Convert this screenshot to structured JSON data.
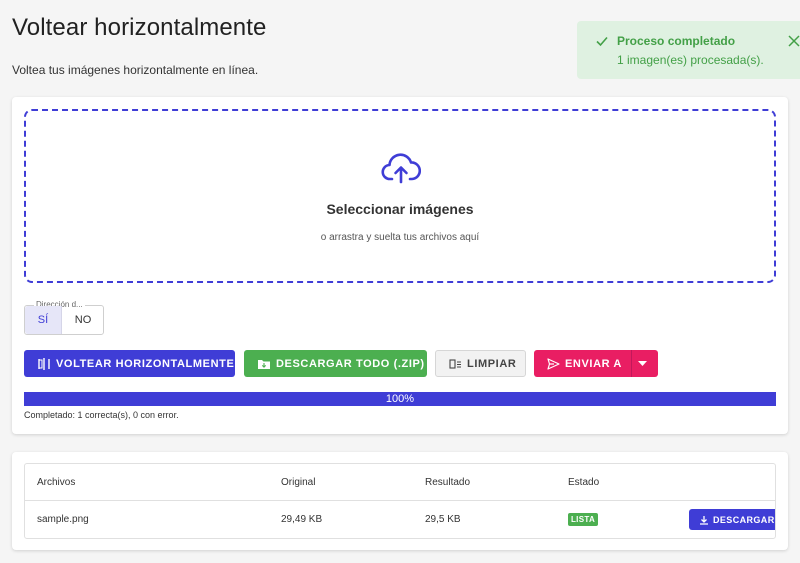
{
  "header": {
    "title": "Voltear horizontalmente",
    "subtitle": "Voltea tus imágenes horizontalmente en línea."
  },
  "toast": {
    "title": "Proceso completado",
    "message": "1 imagen(es) procesada(s).",
    "icon": "check-icon",
    "color": "#43a047"
  },
  "dropzone": {
    "icon": "cloud-upload-icon",
    "title": "Seleccionar imágenes",
    "hint": "o arrastra y suelta tus archivos aquí"
  },
  "direction": {
    "legend": "Dirección d...",
    "options": [
      "SÍ",
      "NO"
    ],
    "selected": "SÍ"
  },
  "actions": {
    "flip_label": "VOLTEAR HORIZONTALMENTE",
    "zip_label": "DESCARGAR TODO (.ZIP)",
    "clear_label": "LIMPIAR",
    "send_label": "ENVIAR A"
  },
  "progress": {
    "value": 100,
    "label": "100%",
    "status": "Completado: 1 correcta(s), 0 con error."
  },
  "files_table": {
    "headers": [
      "Archivos",
      "Original",
      "Resultado",
      "Estado"
    ],
    "rows": [
      {
        "name": "sample.png",
        "original": "29,49 KB",
        "result": "29,5 KB",
        "status": "LISTA",
        "download_label": "DESCARGAR"
      }
    ]
  },
  "colors": {
    "primary": "#3f3dd6",
    "success": "#4caf50",
    "accent": "#e91e63"
  }
}
